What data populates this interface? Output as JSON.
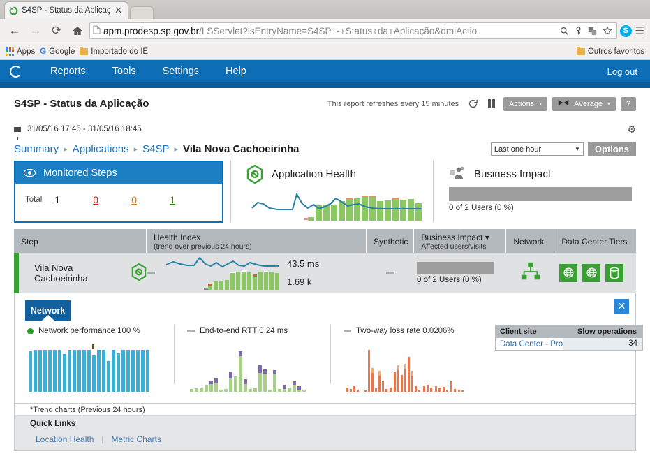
{
  "browser": {
    "tab": {
      "title": "S4SP - Status da Aplicaçã",
      "close_label": "✕",
      "favicon": "refresh-circle-icon"
    },
    "nav": {
      "back": "←",
      "forward": "→",
      "reload": "⟳",
      "home": "⌂"
    },
    "url": {
      "host": "apm.prodesp.sp.gov.br",
      "path": "/LSServlet?lsEntryName=S4SP+-+Status+da+Aplicação&dmiActio"
    },
    "omni_icons": [
      "search-icon",
      "key-icon",
      "extension-icon",
      "star-icon"
    ],
    "right_icons": {
      "skype": "S",
      "menu": "☰"
    },
    "bookmarks": {
      "apps": "Apps",
      "google": "Google",
      "importado": "Importado do IE",
      "outros": "Outros favoritos"
    }
  },
  "appnav": {
    "items": [
      "Reports",
      "Tools",
      "Settings",
      "Help"
    ],
    "logout": "Log out",
    "bg": "#0d6db5"
  },
  "report": {
    "title": "S4SP - Status da Aplicação",
    "refresh_note": "This report refreshes every 15 minutes",
    "actions_label": "Actions",
    "average_label": "Average",
    "help_label": "?",
    "caret": "▾",
    "date_range": "31/05/16 17:45 - 31/05/16 18:45",
    "gear": "⚙"
  },
  "breadcrumb": {
    "items": [
      "Summary",
      "Applications",
      "S4SP"
    ],
    "current": "Vila Nova Cachoeirinha",
    "separator": "▸",
    "time_select": "Last one hour",
    "options_label": "Options"
  },
  "cards": {
    "monitored_steps": {
      "title": "Monitored Steps",
      "total_label": "Total",
      "total": "1",
      "critical": "0",
      "warning": "0",
      "ok": "1"
    },
    "application_health": {
      "title": "Application Health"
    },
    "business_impact": {
      "title": "Business Impact",
      "text": "0 of 2 Users (0 %)"
    }
  },
  "table": {
    "headers": {
      "step": "Step",
      "health_index": "Health Index",
      "health_index_sub": "(trend over previous 24 hours)",
      "synthetic": "Synthetic",
      "business_impact": "Business Impact ▾",
      "business_impact_sub": "Affected users/visits",
      "network": "Network",
      "data_center_tiers": "Data Center Tiers"
    },
    "rows": [
      {
        "step": "Vila Nova Cachoeirinha",
        "status": "ok",
        "health_dash": "—",
        "response_time": "43.5 ms",
        "throughput": "1.69 k",
        "synthetic": "—",
        "business_impact_text": "0 of 2 Users (0 %)",
        "network_icon": "network-topology-icon",
        "tiers": [
          "globe-icon",
          "globe-icon",
          "database-icon"
        ]
      }
    ]
  },
  "network_panel": {
    "tab_label": "Network",
    "close_label": "✕",
    "metrics": [
      {
        "label": "Network performance 100 %",
        "marker": "dot-green"
      },
      {
        "label": "End-to-end RTT 0.24 ms",
        "marker": "dash-grey"
      },
      {
        "label": "Two-way loss rate 0.0206%",
        "marker": "dash-grey"
      }
    ],
    "client_table": {
      "col1": "Client site",
      "col2": "Slow operations",
      "rows": [
        {
          "site": "Data Center - Pro...",
          "value": "34"
        }
      ]
    },
    "trend_note": "*Trend charts (Previous 24 hours)",
    "quick_links": {
      "title": "Quick Links",
      "links": [
        "Location Health",
        "Metric Charts"
      ],
      "separator": "|"
    }
  },
  "chart_data": [
    {
      "type": "line",
      "title": "Application Health",
      "name": "application-health-summary",
      "x": [
        0,
        1,
        2,
        3,
        4,
        5,
        6,
        7,
        8,
        9,
        10,
        11,
        12,
        13,
        14,
        15,
        16,
        17,
        18,
        19,
        20,
        21,
        22,
        23
      ],
      "series": [
        {
          "name": "health-line",
          "color": "#2980a8",
          "values": [
            30,
            44,
            38,
            30,
            28,
            28,
            28,
            78,
            48,
            36,
            44,
            32,
            40,
            48,
            62,
            52,
            40,
            44,
            46,
            38,
            34,
            32,
            32,
            33
          ]
        },
        {
          "name": "health-bars",
          "color": "#8cc861",
          "values": [
            0,
            0,
            0,
            0,
            0,
            0,
            0,
            3,
            38,
            40,
            41,
            46,
            60,
            66,
            68,
            72,
            72,
            60,
            62,
            66,
            64,
            64,
            66,
            54
          ]
        }
      ],
      "grid": false,
      "legend": "none"
    },
    {
      "type": "line",
      "title": "Health Index row trend",
      "name": "row-health-index",
      "x": [
        0,
        1,
        2,
        3,
        4,
        5,
        6,
        7,
        8,
        9,
        10,
        11,
        12,
        13,
        14,
        15,
        16,
        17,
        18,
        19,
        20,
        21,
        22,
        23
      ],
      "series": [
        {
          "name": "response-time",
          "color": "#2980a8",
          "values": [
            28,
            33,
            30,
            27,
            26,
            25,
            26,
            70,
            44,
            33,
            40,
            30,
            36,
            46,
            34,
            30,
            40,
            43,
            30,
            27,
            26,
            25,
            25,
            26
          ]
        },
        {
          "name": "throughput",
          "color": "#8cc861",
          "values": [
            0,
            0,
            0,
            0,
            0,
            0,
            5,
            18,
            22,
            24,
            26,
            48,
            54,
            52,
            50,
            36,
            54,
            52,
            52,
            50,
            52,
            54,
            50,
            44
          ]
        }
      ],
      "labels": {
        "response_time": "43.5 ms",
        "throughput": "1.69 k"
      },
      "grid": false,
      "legend": "none"
    },
    {
      "type": "bar",
      "title": "Network performance 100 %",
      "name": "network-performance-spark",
      "values": [
        60,
        62,
        62,
        62,
        62,
        62,
        62,
        52,
        62,
        62,
        62,
        62,
        62,
        56,
        62,
        62,
        42,
        62,
        52,
        62,
        62,
        62,
        62,
        62,
        62,
        62
      ],
      "color": "#3eaed4",
      "ylim": [
        0,
        70
      ],
      "grid": false
    },
    {
      "type": "bar",
      "title": "End-to-end RTT 0.24 ms",
      "name": "rtt-spark",
      "values": [
        2,
        3,
        4,
        6,
        8,
        10,
        12,
        3,
        2,
        20,
        16,
        46,
        8,
        4,
        2,
        3,
        26,
        22,
        2,
        20,
        3,
        4,
        3,
        9,
        7,
        8,
        3,
        2
      ],
      "color": "#a8d08a",
      "secondary_color": "#7e6aa8",
      "ylim": [
        0,
        50
      ],
      "grid": false
    },
    {
      "type": "bar",
      "title": "Two-way loss rate 0.0206%",
      "name": "loss-rate-spark",
      "values": [
        3,
        2,
        4,
        2,
        2,
        40,
        14,
        2,
        10,
        8,
        2,
        3,
        14,
        16,
        12,
        18,
        34,
        10,
        4,
        3,
        4,
        8,
        6,
        4,
        6,
        4,
        3,
        9,
        6,
        3,
        2,
        4,
        2
      ],
      "color": "#e8764f",
      "ylim": [
        0,
        45
      ],
      "grid": false
    }
  ],
  "colors": {
    "brand_blue": "#0d6db5",
    "status_green": "#3aa033",
    "link_blue": "#1a73c0",
    "header_grey": "#b3b9bd",
    "row_grey": "#dfe1e3"
  }
}
